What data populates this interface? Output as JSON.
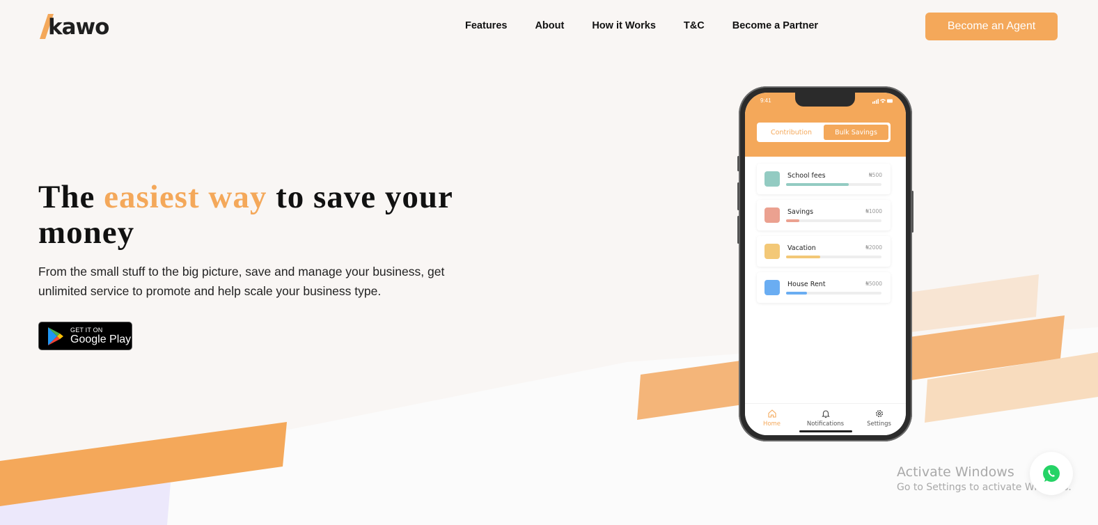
{
  "brand": {
    "name": "kawo",
    "accent": "#f4a85a"
  },
  "nav": {
    "items": [
      "Features",
      "About",
      "How it Works",
      "T&C",
      "Become a Partner"
    ]
  },
  "header": {
    "cta_label": "Become an Agent"
  },
  "hero": {
    "title_before": "The ",
    "title_accent": "easiest way",
    "title_after": " to save your money",
    "subtitle": "From the small stuff to the big picture, save and manage your business, get unlimited service to promote and help scale your business type.",
    "store_small": "GET IT ON",
    "store_big": "Google Play"
  },
  "phone": {
    "time": "9:41",
    "segments": [
      "Contribution",
      "Bulk Savings"
    ],
    "active_segment": "Bulk Savings",
    "cards": [
      {
        "label": "School fees",
        "amount": "₦500",
        "color": "#93cbc2",
        "progress": 0.66
      },
      {
        "label": "Savings",
        "amount": "₦1000",
        "color": "#eba190",
        "progress": 0.14
      },
      {
        "label": "Vacation",
        "amount": "₦2000",
        "color": "#f3c877",
        "progress": 0.36
      },
      {
        "label": "House Rent",
        "amount": "₦5000",
        "color": "#6aadf2",
        "progress": 0.22
      }
    ],
    "tabs": [
      "Home",
      "Notifications",
      "Settings"
    ],
    "active_tab": "Home"
  },
  "watermark": {
    "title": "Activate Windows",
    "subtitle": "Go to Settings to activate Windows."
  },
  "icons": [
    "logo-mark-icon",
    "google-play-icon",
    "home-icon",
    "bell-icon",
    "gear-icon",
    "whatsapp-icon",
    "signal-icon",
    "wifi-icon",
    "battery-icon"
  ]
}
